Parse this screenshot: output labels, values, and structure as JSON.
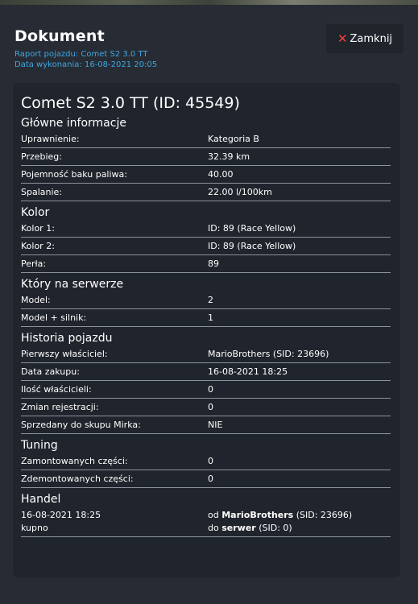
{
  "header": {
    "title": "Dokument",
    "subtitle_report": "Raport pojazdu: Comet S2 3.0 TT",
    "subtitle_date": "Data wykonania: 16-08-2021 20:05",
    "close_label": "Zamknij",
    "close_icon": "close-icon"
  },
  "vehicle_title": "Comet S2 3.0 TT (ID: 45549)",
  "sections": {
    "main": {
      "title": "Główne informacje",
      "rows": [
        {
          "k": "Uprawnienie:",
          "v": "Kategoria B"
        },
        {
          "k": "Przebieg:",
          "v": "32.39 km"
        },
        {
          "k": "Pojemność baku paliwa:",
          "v": "40.00"
        },
        {
          "k": "Spalanie:",
          "v": "22.00 l/100km"
        }
      ]
    },
    "color": {
      "title": "Kolor",
      "rows": [
        {
          "k": "Kolor 1:",
          "v": "ID: 89 (Race Yellow)"
        },
        {
          "k": "Kolor 2:",
          "v": "ID: 89 (Race Yellow)"
        },
        {
          "k": "Perła:",
          "v": "89"
        }
      ]
    },
    "server": {
      "title": "Który na serwerze",
      "rows": [
        {
          "k": "Model:",
          "v": "2"
        },
        {
          "k": "Model + silnik:",
          "v": "1"
        }
      ]
    },
    "history": {
      "title": "Historia pojazdu",
      "rows": [
        {
          "k": "Pierwszy właściciel:",
          "v": "MarioBrothers (SID: 23696)"
        },
        {
          "k": "Data zakupu:",
          "v": "16-08-2021 18:25"
        },
        {
          "k": "Ilość właścicieli:",
          "v": "0"
        },
        {
          "k": "Zmian rejestracji:",
          "v": "0"
        },
        {
          "k": "Sprzedany do skupu Mirka:",
          "v": "NIE"
        }
      ]
    },
    "tuning": {
      "title": "Tuning",
      "rows": [
        {
          "k": "Zamontowanych części:",
          "v": "0"
        },
        {
          "k": "Zdemontowanych części:",
          "v": "0"
        }
      ]
    },
    "trade": {
      "title": "Handel",
      "date": "16-08-2021 18:25",
      "type": "kupno",
      "from_prefix": "od",
      "from_name": "MarioBrothers",
      "from_sid": "(SID: 23696)",
      "to_prefix": "do",
      "to_name": "serwer",
      "to_sid": "(SID: 0)"
    }
  }
}
